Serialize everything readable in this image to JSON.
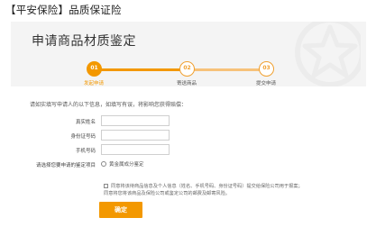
{
  "header": {
    "title": "【平安保险】品质保证险"
  },
  "banner": {
    "title": "申请商品材质鉴定",
    "background_color": "#f4f4f4",
    "decoration_icon": "star-outline-icon"
  },
  "steps": [
    {
      "number": "01",
      "label": "发起申请",
      "active": true
    },
    {
      "number": "02",
      "label": "寄送商品",
      "active": false
    },
    {
      "number": "03",
      "label": "提交申请",
      "active": false
    }
  ],
  "form": {
    "instruction": "请如实填写申请人的以下信息，如填写有误，将影响您获得赔偿：",
    "fields": [
      {
        "label": "真实姓名",
        "value": "",
        "placeholder": ""
      },
      {
        "label": "身份证号码",
        "value": "",
        "placeholder": ""
      },
      {
        "label": "手机号码",
        "value": "",
        "placeholder": ""
      }
    ],
    "appraisal_label": "请选择您要申请的鉴定项目",
    "appraisal_option": "黄金属成分鉴定"
  },
  "agreement": {
    "line1": "同意将该待商品信息及个人信息（姓名、手机号码、身份证号码）提交给保险公司用于报案；",
    "line2": "同意将您将该商品及保险公司或鉴定公司的邮费及邮寄风险。"
  },
  "actions": {
    "confirm_label": "确定"
  },
  "colors": {
    "accent": "#f39800",
    "banner_bg": "#f4f4f4",
    "line_active": "#f39800",
    "line_inactive": "#f7c27a"
  }
}
